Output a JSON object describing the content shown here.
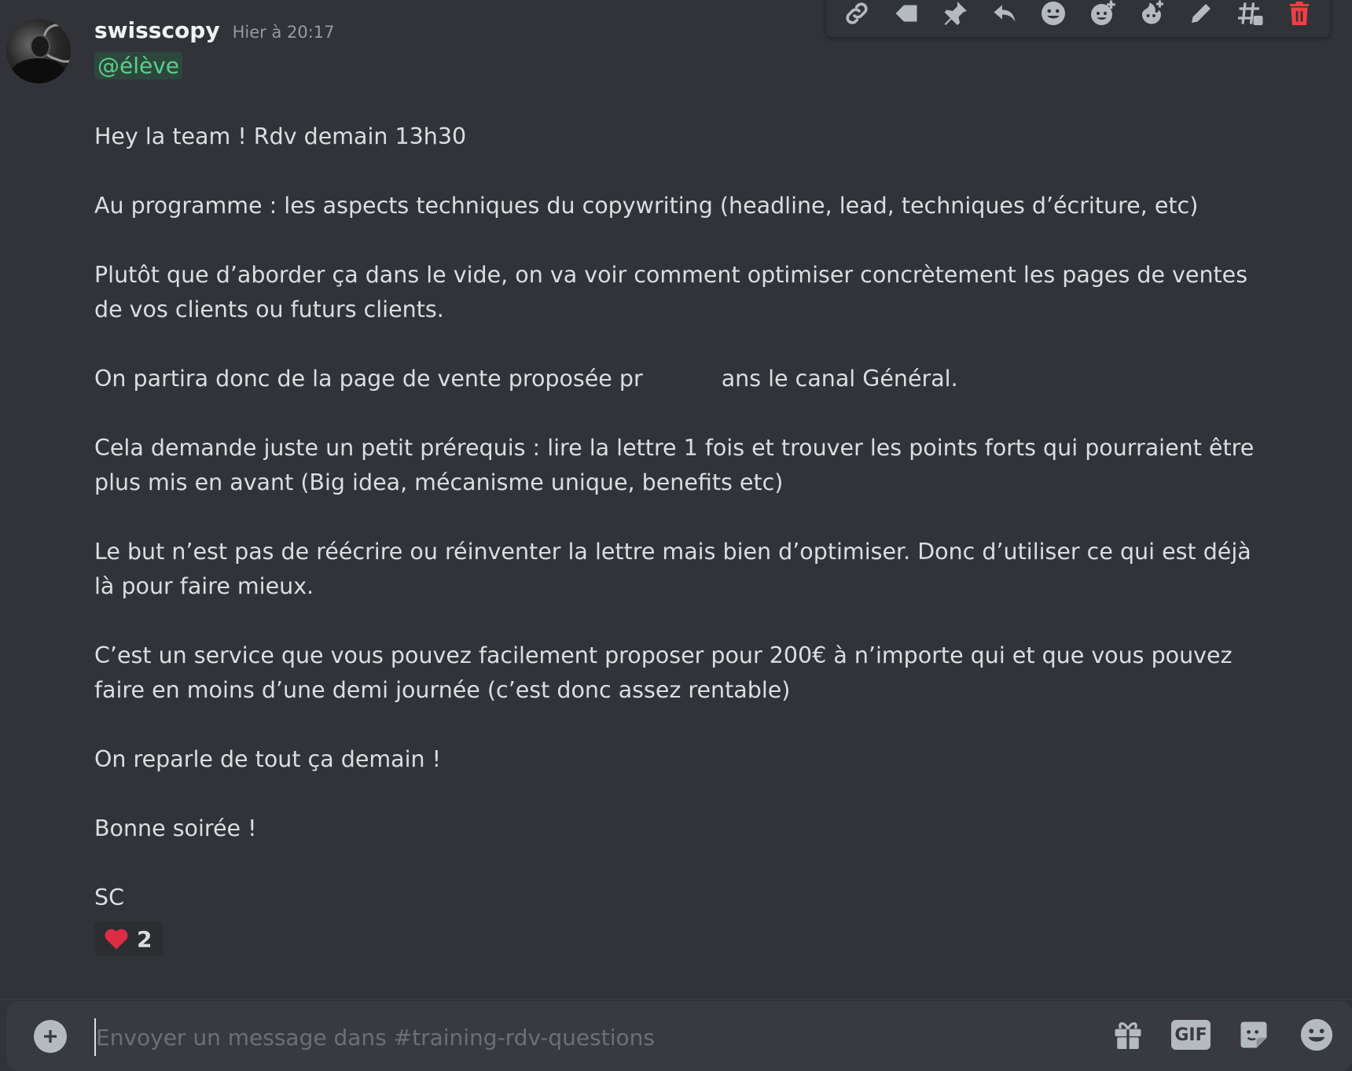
{
  "message": {
    "author": "swisscopy",
    "timestamp": "Hier à 20:17",
    "mention": "@élève",
    "lines": {
      "p1": "Hey  la team !  Rdv demain 13h30",
      "p2": "Au programme : les aspects techniques du copywriting  (headline, lead, techniques d’écriture, etc)",
      "p3": "Plutôt que d’aborder ça dans le vide, on va voir comment optimiser concrètement les pages de ventes de vos clients ou futurs clients.",
      "p4a": "On partira donc de la page de vente proposée pr",
      "p4b": "ans le canal Général.",
      "p5": "Cela demande juste un petit prérequis : lire la lettre 1 fois et trouver les points forts qui pourraient être plus mis en avant (Big idea, mécanisme unique, benefits etc)",
      "p6": "Le but n’est pas de réécrire ou réinventer la lettre mais bien d’optimiser. Donc d’utiliser ce qui est déjà là pour faire mieux.",
      "p7": "C’est un service que vous pouvez facilement proposer pour 200€ à n’importe qui et que vous pouvez faire en moins d’une demi journée (c’est donc assez rentable)",
      "p8": "On reparle de tout ça demain !",
      "p9": "Bonne soirée !",
      "p10": "SC"
    },
    "reaction": {
      "emoji": "heart-icon",
      "count": "2"
    }
  },
  "toolbar_icons": [
    "link-icon",
    "tag-icon",
    "pin-icon",
    "reply-icon",
    "emoji-icon",
    "add-reaction-icon",
    "super-reaction-icon",
    "edit-icon",
    "thread-icon",
    "delete-icon"
  ],
  "composer": {
    "placeholder": "Envoyer un message dans #training-rdv-questions",
    "gif_label": "GIF",
    "icons": [
      "gift-icon",
      "gif-icon",
      "sticker-icon",
      "emoji-icon"
    ]
  },
  "colors": {
    "background": "#313338",
    "mention": "#58d08a",
    "delete": "#f23f43",
    "heart": "#dd2e44"
  }
}
